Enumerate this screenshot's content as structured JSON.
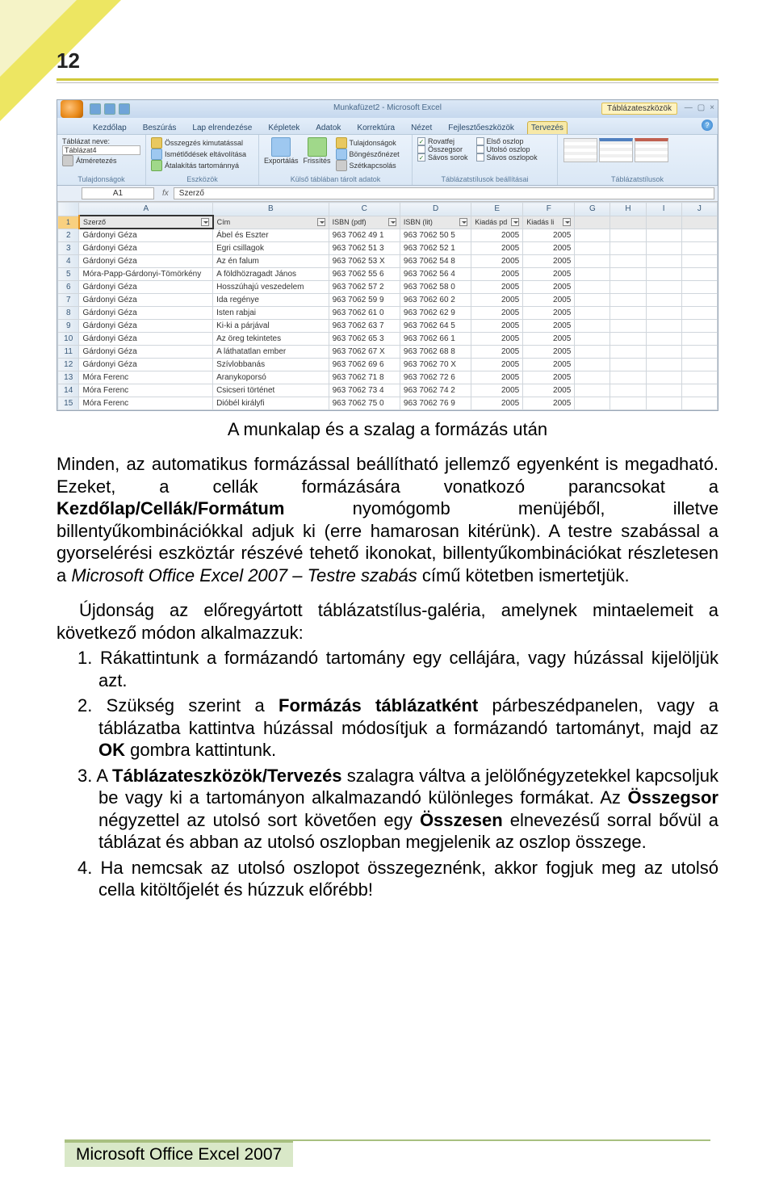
{
  "page_number": "12",
  "excel": {
    "title": "Munkafüzet2 - Microsoft Excel",
    "contextual_tab": "Táblázateszközök",
    "tabs": [
      "Kezdőlap",
      "Beszúrás",
      "Lap elrendezése",
      "Képletek",
      "Adatok",
      "Korrektúra",
      "Nézet",
      "Fejlesztőeszközök",
      "Tervezés"
    ],
    "ribbon_groups": {
      "g1": {
        "lines": [
          "Táblázat neve:",
          "Táblázat4",
          "Átméretezés"
        ],
        "label": "Tulajdonságok"
      },
      "g2": {
        "lines": [
          "Összegzés kimutatással",
          "Ismétlődések eltávolítása",
          "Átalakítás tartománnyá"
        ],
        "label": "Eszközök"
      },
      "g3": {
        "btn1": "Exportálás",
        "btn2": "Frissítés",
        "lines": [
          "Tulajdonságok",
          "Böngészőnézet",
          "Szétkapcsolás"
        ],
        "label": "Külső táblában tárolt adatok"
      },
      "g4": {
        "c1": [
          "Rovatfej",
          "Összegsor",
          "Sávos sorok"
        ],
        "c2": [
          "Első oszlop",
          "Utolsó oszlop",
          "Sávos oszlopok"
        ],
        "label": "Táblázatstílusok beállításai"
      },
      "g5": {
        "label": "Táblázatstílusok"
      }
    },
    "namebox": "A1",
    "formula": "Szerző",
    "columns": [
      "A",
      "B",
      "C",
      "D",
      "E",
      "F",
      "G",
      "H",
      "I",
      "J"
    ],
    "headers": [
      "Szerző",
      "Cím",
      "ISBN (pdf)",
      "ISBN (lit)",
      "Kiadás pd",
      "Kiadás li"
    ],
    "rows": [
      {
        "n": "1",
        "a": "Szerző",
        "b": "Cím",
        "c": "ISBN (pdf)",
        "d": "ISBN (lit)",
        "e": "Kiadás pd",
        "f": "Kiadás li"
      },
      {
        "n": "2",
        "a": "Gárdonyi Géza",
        "b": "Ábel és Eszter",
        "c": "963 7062 49 1",
        "d": "963 7062 50 5",
        "e": "2005",
        "f": "2005"
      },
      {
        "n": "3",
        "a": "Gárdonyi Géza",
        "b": "Egri csillagok",
        "c": "963 7062 51 3",
        "d": "963 7062 52 1",
        "e": "2005",
        "f": "2005"
      },
      {
        "n": "4",
        "a": "Gárdonyi Géza",
        "b": "Az én falum",
        "c": "963 7062 53 X",
        "d": "963 7062 54 8",
        "e": "2005",
        "f": "2005"
      },
      {
        "n": "5",
        "a": "Móra-Papp-Gárdonyi-Tömörkény",
        "b": "A földhözragadt János",
        "c": "963 7062 55 6",
        "d": "963 7062 56 4",
        "e": "2005",
        "f": "2005"
      },
      {
        "n": "6",
        "a": "Gárdonyi Géza",
        "b": "Hosszúhajú veszedelem",
        "c": "963 7062 57 2",
        "d": "963 7062 58 0",
        "e": "2005",
        "f": "2005"
      },
      {
        "n": "7",
        "a": "Gárdonyi Géza",
        "b": "Ida regénye",
        "c": "963 7062 59 9",
        "d": "963 7062 60 2",
        "e": "2005",
        "f": "2005"
      },
      {
        "n": "8",
        "a": "Gárdonyi Géza",
        "b": "Isten rabjai",
        "c": "963 7062 61 0",
        "d": "963 7062 62 9",
        "e": "2005",
        "f": "2005"
      },
      {
        "n": "9",
        "a": "Gárdonyi Géza",
        "b": "Ki-ki a párjával",
        "c": "963 7062 63 7",
        "d": "963 7062 64 5",
        "e": "2005",
        "f": "2005"
      },
      {
        "n": "10",
        "a": "Gárdonyi Géza",
        "b": "Az öreg tekintetes",
        "c": "963 7062 65 3",
        "d": "963 7062 66 1",
        "e": "2005",
        "f": "2005"
      },
      {
        "n": "11",
        "a": "Gárdonyi Géza",
        "b": "A láthatatlan ember",
        "c": "963 7062 67 X",
        "d": "963 7062 68 8",
        "e": "2005",
        "f": "2005"
      },
      {
        "n": "12",
        "a": "Gárdonyi Géza",
        "b": "Szívlobbanás",
        "c": "963 7062 69 6",
        "d": "963 7062 70 X",
        "e": "2005",
        "f": "2005"
      },
      {
        "n": "13",
        "a": "Móra Ferenc",
        "b": "Aranykoporsó",
        "c": "963 7062 71 8",
        "d": "963 7062 72 6",
        "e": "2005",
        "f": "2005"
      },
      {
        "n": "14",
        "a": "Móra Ferenc",
        "b": "Csicseri történet",
        "c": "963 7062 73 4",
        "d": "963 7062 74 2",
        "e": "2005",
        "f": "2005"
      },
      {
        "n": "15",
        "a": "Móra Ferenc",
        "b": "Dióbél királyfi",
        "c": "963 7062 75 0",
        "d": "963 7062 76 9",
        "e": "2005",
        "f": "2005"
      }
    ]
  },
  "caption": "A munkalap és a szalag a formázás után",
  "para1a": "Minden, az automatikus formázással beállítható jellemző egyenként is megadható. Ezeket, a cellák formázására vonatkozó parancsokat a ",
  "para1b": "Kezdőlap/Cellák/Formátum",
  "para1c": " nyomógomb menüjéből, illetve billentyűkombinációkkal adjuk ki (erre hamarosan kitérünk). A testre szabással a gyorselérési eszköztár részévé tehető ikonokat, billentyűkombinációkat részletesen a ",
  "para1d": "Microsoft Office Excel 2007 – Testre szabás",
  "para1e": " című kötetben ismertetjük.",
  "para2": "Újdonság az előregyártott táblázatstílus-galéria, amelynek mintaelemeit a következő módon alkalmazzuk:",
  "li1": "1. Rákattintunk a formázandó tartomány egy cellájára, vagy húzással kijelöljük azt.",
  "li2a": "2. Szükség szerint a ",
  "li2b": "Formázás táblázatként",
  "li2c": " párbeszédpanelen, vagy a táblázatba kattintva húzással módosítjuk a formázandó tartományt, majd az ",
  "li2d": "OK",
  "li2e": " gombra kattintunk.",
  "li3a": "3. A ",
  "li3b": "Táblázateszközök/Tervezés",
  "li3c": " szalagra váltva a jelölőnégyzetekkel kapcsoljuk be vagy ki a tartományon alkalmazandó különleges formákat. Az ",
  "li3d": "Összegsor",
  "li3e": " négyzettel az utolsó sort követően egy ",
  "li3f": "Összesen",
  "li3g": " elnevezésű sorral bővül a táblázat és abban az utolsó oszlopban megjelenik az oszlop összege.",
  "li4": "4. Ha nemcsak az utolsó oszlopot összegeznénk, akkor fogjuk meg az utolsó cella kitöltőjelét és húzzuk előrébb!",
  "footer": "Microsoft Office Excel 2007"
}
